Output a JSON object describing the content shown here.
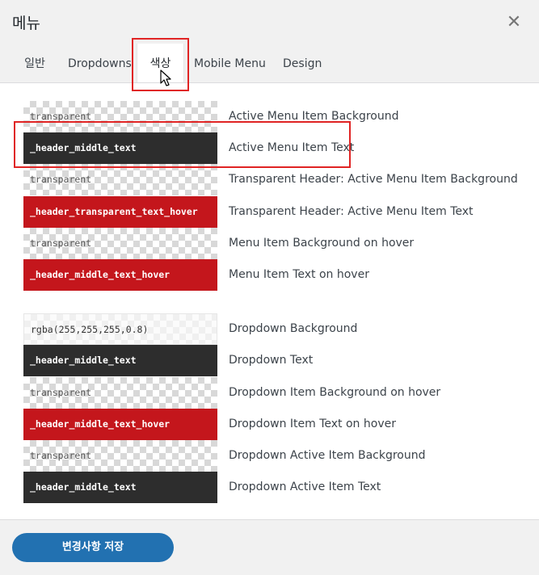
{
  "header": {
    "title": "메뉴",
    "close_icon": "close-icon"
  },
  "tabs": [
    {
      "label": "일반",
      "active": false
    },
    {
      "label": "Dropdowns",
      "active": false
    },
    {
      "label": "색상",
      "active": true
    },
    {
      "label": "Mobile Menu",
      "active": false
    },
    {
      "label": "Design",
      "active": false
    }
  ],
  "colors": {
    "accent": "#2271b1",
    "dark_swatch": "#2d2d2d",
    "red_swatch": "#c4161c",
    "highlight": "#e02424"
  },
  "menu_colors": [
    {
      "value": "transparent",
      "label": "Active Menu Item Background",
      "style": "checker"
    },
    {
      "value": "_header_middle_text",
      "label": "Active Menu Item Text",
      "style": "dark"
    },
    {
      "value": "transparent",
      "label": "Transparent Header: Active Menu Item Background",
      "style": "checker"
    },
    {
      "value": "_header_transparent_text_hover",
      "label": "Transparent Header: Active Menu Item Text",
      "style": "red"
    },
    {
      "value": "transparent",
      "label": "Menu Item Background on hover",
      "style": "checker"
    },
    {
      "value": "_header_middle_text_hover",
      "label": "Menu Item Text on hover",
      "style": "red"
    }
  ],
  "dropdown_colors": [
    {
      "value": "rgba(255,255,255,0.8)",
      "label": "Dropdown Background",
      "style": "light"
    },
    {
      "value": "_header_middle_text",
      "label": "Dropdown Text",
      "style": "dark"
    },
    {
      "value": "transparent",
      "label": "Dropdown Item Background on hover",
      "style": "checker"
    },
    {
      "value": "_header_middle_text_hover",
      "label": "Dropdown Item Text on hover",
      "style": "red"
    },
    {
      "value": "transparent",
      "label": "Dropdown Active Item Background",
      "style": "checker"
    },
    {
      "value": "_header_middle_text",
      "label": "Dropdown Active Item Text",
      "style": "dark"
    }
  ],
  "footer": {
    "save_label": "변경사항 저장"
  }
}
